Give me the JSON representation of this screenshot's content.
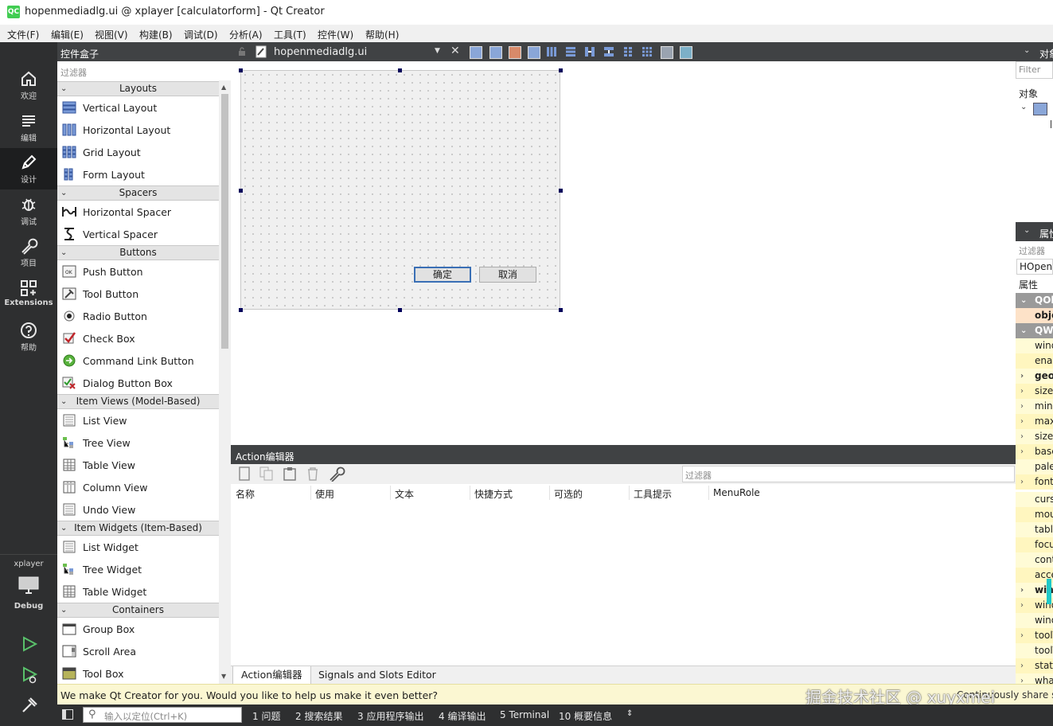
{
  "window": {
    "logo_text": "QC",
    "title": "hopenmediadlg.ui @ xplayer [calculatorform] - Qt Creator"
  },
  "menubar": [
    "文件(F)",
    "编辑(E)",
    "视图(V)",
    "构建(B)",
    "调试(D)",
    "分析(A)",
    "工具(T)",
    "控件(W)",
    "帮助(H)"
  ],
  "modes": [
    {
      "label": "欢迎",
      "icon": "home-icon"
    },
    {
      "label": "编辑",
      "icon": "edit-lines-icon"
    },
    {
      "label": "设计",
      "icon": "pen-icon"
    },
    {
      "label": "调试",
      "icon": "bug-icon"
    },
    {
      "label": "项目",
      "icon": "wrench-icon"
    },
    {
      "label": "Extensions",
      "icon": "extensions-icon"
    },
    {
      "label": "帮助",
      "icon": "help-icon"
    }
  ],
  "target": {
    "project": "xplayer",
    "config": "Debug"
  },
  "widgetbox": {
    "title": "控件盒子",
    "filter_placeholder": "过滤器",
    "categories": [
      {
        "name": "Layouts",
        "items": [
          "Vertical Layout",
          "Horizontal Layout",
          "Grid Layout",
          "Form Layout"
        ]
      },
      {
        "name": "Spacers",
        "items": [
          "Horizontal Spacer",
          "Vertical Spacer"
        ]
      },
      {
        "name": "Buttons",
        "items": [
          "Push Button",
          "Tool Button",
          "Radio Button",
          "Check Box",
          "Command Link Button",
          "Dialog Button Box"
        ]
      },
      {
        "name": "Item Views (Model-Based)",
        "items": [
          "List View",
          "Tree View",
          "Table View",
          "Column View",
          "Undo View"
        ]
      },
      {
        "name": "Item Widgets (Item-Based)",
        "items": [
          "List Widget",
          "Tree Widget",
          "Table Widget"
        ]
      },
      {
        "name": "Containers",
        "items": [
          "Group Box",
          "Scroll Area",
          "Tool Box"
        ]
      }
    ]
  },
  "editor": {
    "file_name": "hopenmediadlg.ui",
    "form_buttons": {
      "ok": "确定",
      "cancel": "取消"
    }
  },
  "action_editor": {
    "title": "Action编辑器",
    "filter_placeholder": "过滤器",
    "columns": [
      "名称",
      "使用",
      "文本",
      "快捷方式",
      "可选的",
      "工具提示",
      "MenuRole"
    ],
    "tabs": [
      "Action编辑器",
      "Signals and Slots Editor"
    ],
    "active_tab": 0
  },
  "object_inspector": {
    "title": "对象",
    "filter_placeholder": "Filter",
    "column": "对象"
  },
  "property_editor": {
    "title": "属性",
    "filter_placeholder": "过滤器",
    "object_name": "HOpenMediaDlg",
    "column": "属性",
    "rows": [
      {
        "text": "QObject",
        "kind": "group"
      },
      {
        "text": "objectName",
        "kind": "bold-pink"
      },
      {
        "text": "QWidget",
        "kind": "group"
      },
      {
        "text": "windowModality",
        "kind": "yellow"
      },
      {
        "text": "enabled",
        "kind": "yellow"
      },
      {
        "text": "geometry",
        "kind": "yellow-bold-expand"
      },
      {
        "text": "sizePolicy",
        "kind": "yellow-expand"
      },
      {
        "text": "minimumSize",
        "kind": "yellow-expand"
      },
      {
        "text": "maximumSize",
        "kind": "yellow-expand"
      },
      {
        "text": "sizeIncrement",
        "kind": "yellow-expand"
      },
      {
        "text": "baseSize",
        "kind": "yellow-expand"
      },
      {
        "text": "palette",
        "kind": "yellow"
      },
      {
        "text": "font",
        "kind": "yellow-expand"
      },
      {
        "text": "cursor",
        "kind": "yellow"
      },
      {
        "text": "mouseTracking",
        "kind": "yellow"
      },
      {
        "text": "tabletTracking",
        "kind": "yellow"
      },
      {
        "text": "focusPolicy",
        "kind": "yellow"
      },
      {
        "text": "contextMenuPolicy",
        "kind": "yellow"
      },
      {
        "text": "acceptDrops",
        "kind": "yellow"
      },
      {
        "text": "windowTitle",
        "kind": "yellow-bold-expand"
      },
      {
        "text": "windowIcon",
        "kind": "yellow-expand"
      },
      {
        "text": "windowOpacity",
        "kind": "yellow"
      },
      {
        "text": "toolTip",
        "kind": "yellow-expand"
      },
      {
        "text": "toolTipDuration",
        "kind": "yellow"
      },
      {
        "text": "statusTip",
        "kind": "yellow-expand"
      },
      {
        "text": "whatsThis",
        "kind": "yellow-expand"
      }
    ]
  },
  "infobar": {
    "text": "We make Qt Creator for you. Would you like to help us make it even better?",
    "trailing": "Continuously share statistic"
  },
  "watermark": "掘金技术社区 @ xuyxmei",
  "statusbar": {
    "locator_placeholder": "输入以定位(Ctrl+K)",
    "items": [
      "1 问题",
      "2 搜索结果",
      "3 应用程序输出",
      "4 编译输出",
      "5 Terminal",
      "10 概要信息"
    ]
  },
  "colors": {
    "accent_green": "#41cd52",
    "dark_panel": "#404244",
    "modebar": "#2e2f30",
    "infobar": "#fbf7d2"
  }
}
